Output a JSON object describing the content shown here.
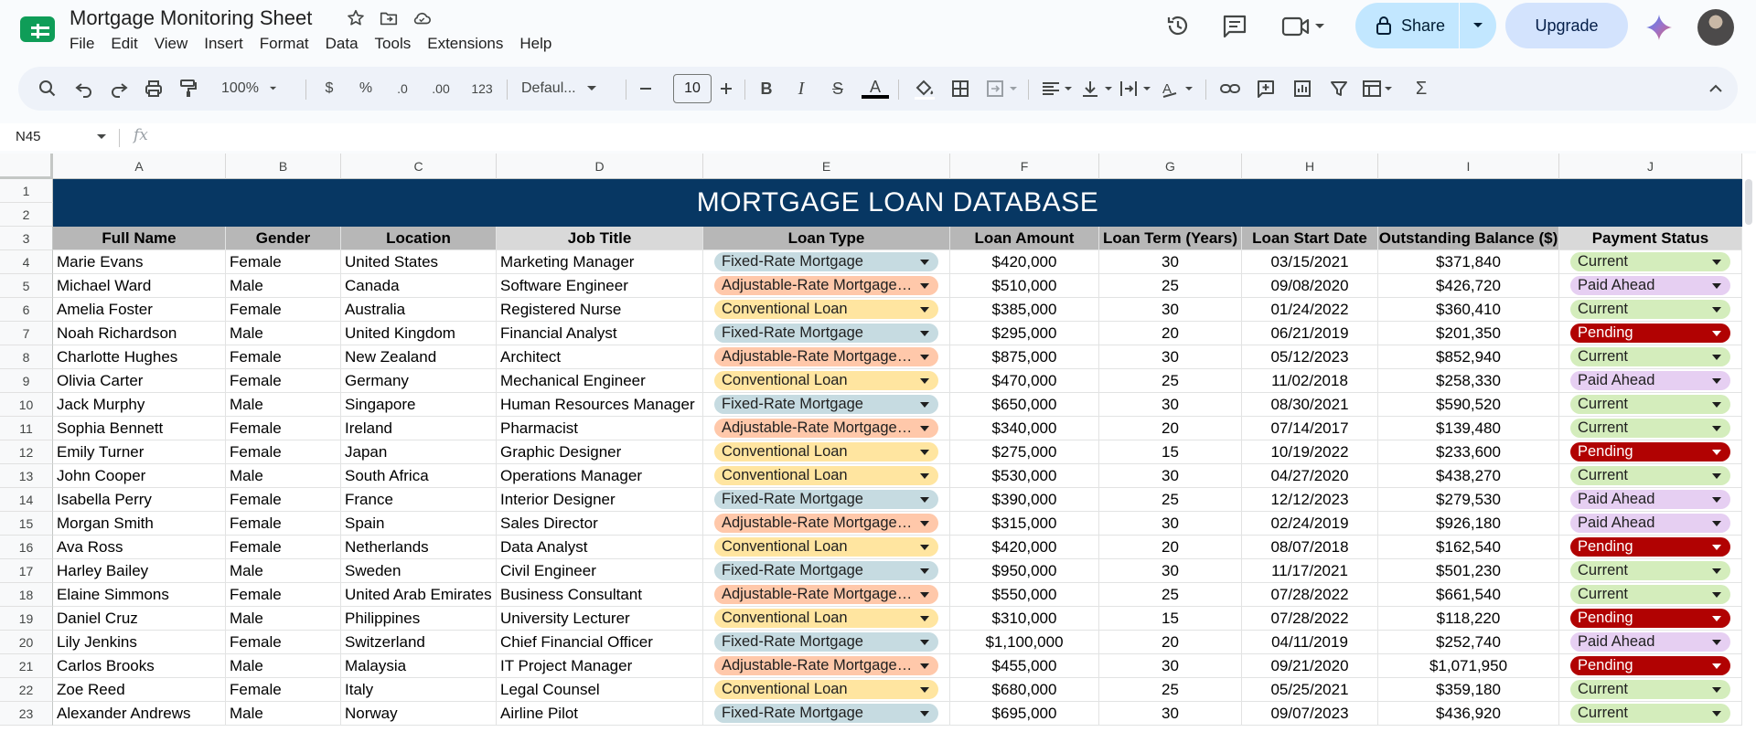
{
  "app": {
    "title": "Mortgage Monitoring Sheet",
    "menu": [
      "File",
      "Edit",
      "View",
      "Insert",
      "Format",
      "Data",
      "Tools",
      "Extensions",
      "Help"
    ],
    "share_label": "Share",
    "upgrade_label": "Upgrade"
  },
  "toolbar": {
    "zoom": "100%",
    "currency": "$",
    "percent": "%",
    "dec_decrease": ".0",
    "dec_increase": ".00",
    "number_format": "123",
    "font": "Defaul...",
    "font_size": "10"
  },
  "formula_bar": {
    "name_box": "N45",
    "fx_label": "fx"
  },
  "columns": [
    "A",
    "B",
    "C",
    "D",
    "E",
    "F",
    "G",
    "H",
    "I",
    "J"
  ],
  "row_numbers": [
    "1",
    "2",
    "3",
    "4",
    "5",
    "6",
    "7",
    "8",
    "9",
    "10",
    "11",
    "12",
    "13",
    "14",
    "15",
    "16",
    "17",
    "18",
    "19",
    "20",
    "21",
    "22",
    "23"
  ],
  "sheet": {
    "banner": "MORTGAGE LOAN DATABASE",
    "headers": [
      "Full Name",
      "Gender",
      "Location",
      "Job Title",
      "Loan Type",
      "Loan Amount",
      "Loan Term (Years)",
      "Loan Start Date",
      "Outstanding Balance ($)",
      "Payment Status"
    ],
    "rows": [
      [
        "Marie Evans",
        "Female",
        "United States",
        "Marketing Manager",
        "Fixed-Rate Mortgage",
        "$420,000",
        "30",
        "03/15/2021",
        "$371,840",
        "Current"
      ],
      [
        "Michael Ward",
        "Male",
        "Canada",
        "Software Engineer",
        "Adjustable-Rate Mortgage (ARM)",
        "$510,000",
        "25",
        "09/08/2020",
        "$426,720",
        "Paid Ahead"
      ],
      [
        "Amelia Foster",
        "Female",
        "Australia",
        "Registered Nurse",
        "Conventional Loan",
        "$385,000",
        "30",
        "01/24/2022",
        "$360,410",
        "Current"
      ],
      [
        "Noah Richardson",
        "Male",
        "United Kingdom",
        "Financial Analyst",
        "Fixed-Rate Mortgage",
        "$295,000",
        "20",
        "06/21/2019",
        "$201,350",
        "Pending"
      ],
      [
        "Charlotte Hughes",
        "Female",
        "New Zealand",
        "Architect",
        "Adjustable-Rate Mortgage (ARM)",
        "$875,000",
        "30",
        "05/12/2023",
        "$852,940",
        "Current"
      ],
      [
        "Olivia Carter",
        "Female",
        "Germany",
        "Mechanical Engineer",
        "Conventional Loan",
        "$470,000",
        "25",
        "11/02/2018",
        "$258,330",
        "Paid Ahead"
      ],
      [
        "Jack Murphy",
        "Male",
        "Singapore",
        "Human Resources Manager",
        "Fixed-Rate Mortgage",
        "$650,000",
        "30",
        "08/30/2021",
        "$590,520",
        "Current"
      ],
      [
        "Sophia Bennett",
        "Female",
        "Ireland",
        "Pharmacist",
        "Adjustable-Rate Mortgage (ARM)",
        "$340,000",
        "20",
        "07/14/2017",
        "$139,480",
        "Current"
      ],
      [
        "Emily Turner",
        "Female",
        "Japan",
        "Graphic Designer",
        "Conventional Loan",
        "$275,000",
        "15",
        "10/19/2022",
        "$233,600",
        "Pending"
      ],
      [
        "John Cooper",
        "Male",
        "South Africa",
        "Operations Manager",
        "Conventional Loan",
        "$530,000",
        "30",
        "04/27/2020",
        "$438,270",
        "Current"
      ],
      [
        "Isabella Perry",
        "Female",
        "France",
        "Interior Designer",
        "Fixed-Rate Mortgage",
        "$390,000",
        "25",
        "12/12/2023",
        "$279,530",
        "Paid Ahead"
      ],
      [
        "Morgan Smith",
        "Female",
        "Spain",
        "Sales Director",
        "Adjustable-Rate Mortgage (ARM)",
        "$315,000",
        "30",
        "02/24/2019",
        "$926,180",
        "Paid Ahead"
      ],
      [
        "Ava Ross",
        "Female",
        "Netherlands",
        "Data Analyst",
        "Conventional Loan",
        "$420,000",
        "20",
        "08/07/2018",
        "$162,540",
        "Pending"
      ],
      [
        "Harley Bailey",
        "Male",
        "Sweden",
        "Civil Engineer",
        "Fixed-Rate Mortgage",
        "$950,000",
        "30",
        "11/17/2021",
        "$501,230",
        "Current"
      ],
      [
        "Elaine Simmons",
        "Female",
        "United Arab Emirates",
        "Business Consultant",
        "Adjustable-Rate Mortgage (ARM)",
        "$550,000",
        "25",
        "07/28/2022",
        "$661,540",
        "Current"
      ],
      [
        "Daniel Cruz",
        "Male",
        "Philippines",
        "University Lecturer",
        "Conventional Loan",
        "$310,000",
        "15",
        "07/28/2022",
        "$118,220",
        "Pending"
      ],
      [
        "Lily Jenkins",
        "Female",
        "Switzerland",
        "Chief Financial Officer",
        "Fixed-Rate Mortgage",
        "$1,100,000",
        "20",
        "04/11/2019",
        "$252,740",
        "Paid Ahead"
      ],
      [
        "Carlos Brooks",
        "Male",
        "Malaysia",
        "IT Project Manager",
        "Adjustable-Rate Mortgage (ARM)",
        "$455,000",
        "30",
        "09/21/2020",
        "$1,071,950",
        "Pending"
      ],
      [
        "Zoe Reed",
        "Female",
        "Italy",
        "Legal Counsel",
        "Conventional Loan",
        "$680,000",
        "25",
        "05/25/2021",
        "$359,180",
        "Current"
      ],
      [
        "Alexander Andrews",
        "Male",
        "Norway",
        "Airline Pilot",
        "Fixed-Rate Mortgage",
        "$695,000",
        "30",
        "09/07/2023",
        "$436,920",
        "Current"
      ]
    ]
  },
  "chip_colors": {
    "Fixed-Rate Mortgage": "#c6dbe1",
    "Adjustable-Rate Mortgage (ARM)": "#ffc8aa",
    "Conventional Loan": "#ffe5a0",
    "Current": "#d4edbc",
    "Paid Ahead": "#e6cff2",
    "Pending": "#b10202"
  },
  "icons": {
    "title": [
      "star-icon",
      "move-to-folder-icon",
      "cloud-saved-icon"
    ],
    "right": [
      "history-icon",
      "comments-icon",
      "meet-video-icon",
      "gemini-icon"
    ]
  }
}
